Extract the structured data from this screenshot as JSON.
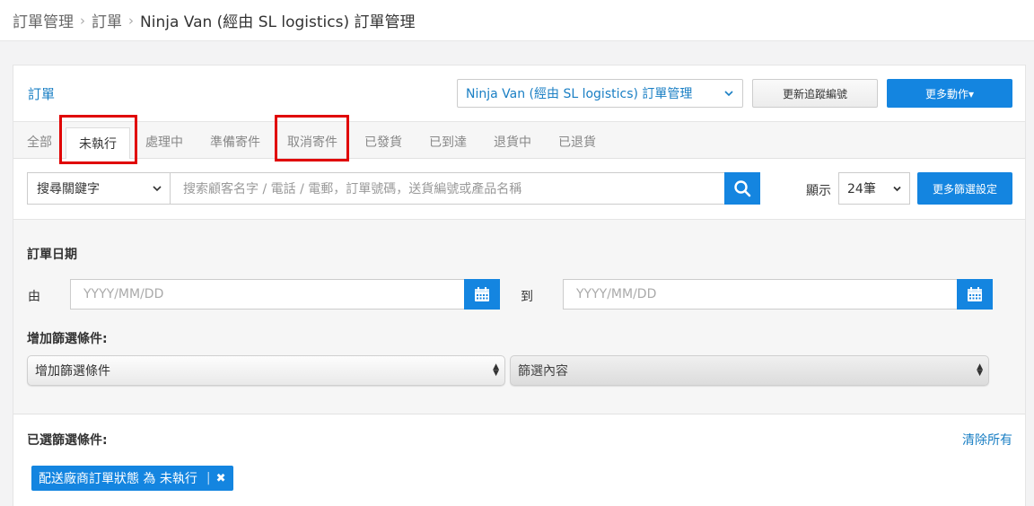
{
  "breadcrumb": [
    "訂單管理",
    "訂單",
    "Ninja Van (經由 SL logistics) 訂單管理"
  ],
  "header": {
    "title": "訂單",
    "shop_select": "Ninja Van (經由 SL logistics) 訂單管理",
    "update_button": "更新追蹤編號",
    "more_button": "更多動作▾"
  },
  "tabs": [
    "全部",
    "未執行",
    "處理中",
    "準備寄件",
    "取消寄件",
    "已發貨",
    "已到達",
    "退貨中",
    "已退貨"
  ],
  "active_tab": "未執行",
  "highlighted_tabs": [
    "未執行",
    "取消寄件"
  ],
  "search": {
    "keyword_select": "搜尋關鍵字",
    "placeholder": "搜索顧客名字 / 電話 / 電郵，訂單號碼，送貨編號或產品名稱",
    "show_label": "顯示",
    "show_value": "24筆",
    "filter_button": "更多篩選設定"
  },
  "filters": {
    "date_title": "訂單日期",
    "from_label": "由",
    "from_placeholder": "YYYY/MM/DD",
    "to_label": "到",
    "to_placeholder": "YYYY/MM/DD",
    "add_title": "增加篩選條件:",
    "add_select": "增加篩選條件",
    "content_select": "篩選內容"
  },
  "selected": {
    "title": "已選篩選條件:",
    "clear_all": "清除所有",
    "chip": "配送廠商訂單狀態 為 未執行"
  },
  "colors": {
    "accent": "#1485e0",
    "link": "#1a7fc4",
    "highlight": "#e00000"
  }
}
